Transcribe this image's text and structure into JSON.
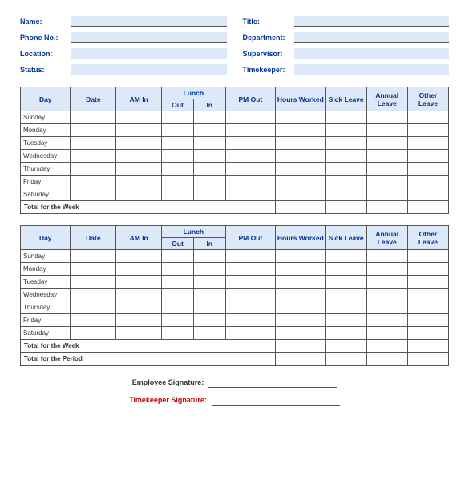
{
  "header": {
    "left": [
      {
        "label": "Name:",
        "id": "name-field"
      },
      {
        "label": "Phone No.:",
        "id": "phone-field"
      },
      {
        "label": "Location:",
        "id": "location-field"
      },
      {
        "label": "Status:",
        "id": "status-field"
      }
    ],
    "right": [
      {
        "label": "Title:",
        "id": "title-field"
      },
      {
        "label": "Department:",
        "id": "dept-field"
      },
      {
        "label": "Supervisor:",
        "id": "supervisor-field"
      },
      {
        "label": "Timekeeper:",
        "id": "timekeeper-field"
      }
    ]
  },
  "table": {
    "columns": {
      "day": "Day",
      "date": "Date",
      "am_in": "AM In",
      "lunch": "Lunch",
      "lunch_out": "Out",
      "lunch_in": "In",
      "pm_out": "PM Out",
      "hours": "Hours Worked",
      "sick": "Sick Leave",
      "annual": "Annual Leave",
      "other": "Other Leave"
    },
    "days": [
      "Sunday",
      "Monday",
      "Tuesday",
      "Wednesday",
      "Thursday",
      "Friday",
      "Saturday"
    ],
    "total_week_label": "Total for the Week",
    "total_period_label": "Total for the Period"
  },
  "signatures": {
    "employee_label": "Employee Signature:",
    "timekeeper_label": "Timekeeper Signature:"
  }
}
